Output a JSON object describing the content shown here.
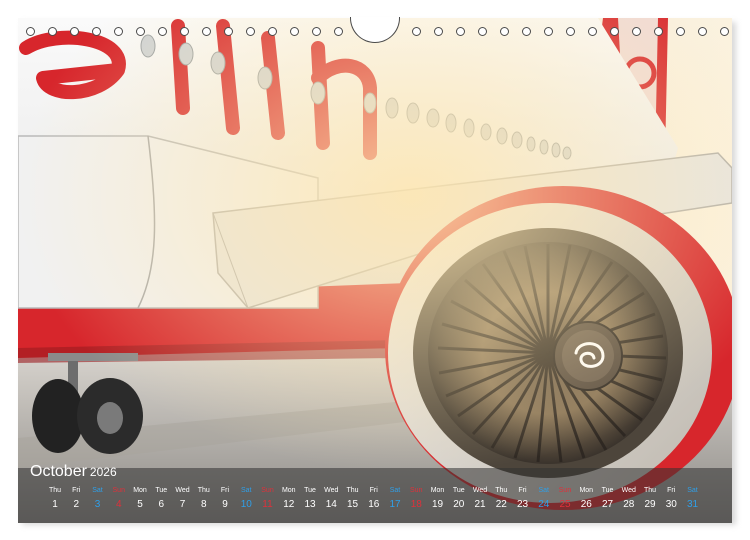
{
  "calendar": {
    "month": "October",
    "year": "2026",
    "days": [
      {
        "dow": "Thu",
        "num": "1",
        "type": "weekday"
      },
      {
        "dow": "Fri",
        "num": "2",
        "type": "weekday"
      },
      {
        "dow": "Sat",
        "num": "3",
        "type": "sat"
      },
      {
        "dow": "Sun",
        "num": "4",
        "type": "sun"
      },
      {
        "dow": "Mon",
        "num": "5",
        "type": "weekday"
      },
      {
        "dow": "Tue",
        "num": "6",
        "type": "weekday"
      },
      {
        "dow": "Wed",
        "num": "7",
        "type": "weekday"
      },
      {
        "dow": "Thu",
        "num": "8",
        "type": "weekday"
      },
      {
        "dow": "Fri",
        "num": "9",
        "type": "weekday"
      },
      {
        "dow": "Sat",
        "num": "10",
        "type": "sat"
      },
      {
        "dow": "Sun",
        "num": "11",
        "type": "sun"
      },
      {
        "dow": "Mon",
        "num": "12",
        "type": "weekday"
      },
      {
        "dow": "Tue",
        "num": "13",
        "type": "weekday"
      },
      {
        "dow": "Wed",
        "num": "14",
        "type": "weekday"
      },
      {
        "dow": "Thu",
        "num": "15",
        "type": "weekday"
      },
      {
        "dow": "Fri",
        "num": "16",
        "type": "weekday"
      },
      {
        "dow": "Sat",
        "num": "17",
        "type": "sat"
      },
      {
        "dow": "Sun",
        "num": "18",
        "type": "sun"
      },
      {
        "dow": "Mon",
        "num": "19",
        "type": "weekday"
      },
      {
        "dow": "Tue",
        "num": "20",
        "type": "weekday"
      },
      {
        "dow": "Wed",
        "num": "21",
        "type": "weekday"
      },
      {
        "dow": "Thu",
        "num": "22",
        "type": "weekday"
      },
      {
        "dow": "Fri",
        "num": "23",
        "type": "weekday"
      },
      {
        "dow": "Sat",
        "num": "24",
        "type": "sat"
      },
      {
        "dow": "Sun",
        "num": "25",
        "type": "sun"
      },
      {
        "dow": "Mon",
        "num": "26",
        "type": "weekday"
      },
      {
        "dow": "Tue",
        "num": "27",
        "type": "weekday"
      },
      {
        "dow": "Wed",
        "num": "28",
        "type": "weekday"
      },
      {
        "dow": "Thu",
        "num": "29",
        "type": "weekday"
      },
      {
        "dow": "Fri",
        "num": "30",
        "type": "weekday"
      },
      {
        "dow": "Sat",
        "num": "31",
        "type": "sat"
      }
    ]
  },
  "colors": {
    "saturday": "#2f9fe8",
    "sunday": "#e0303a",
    "livery_red": "#d7262c"
  },
  "photo": {
    "logo_letters": "erlin"
  }
}
